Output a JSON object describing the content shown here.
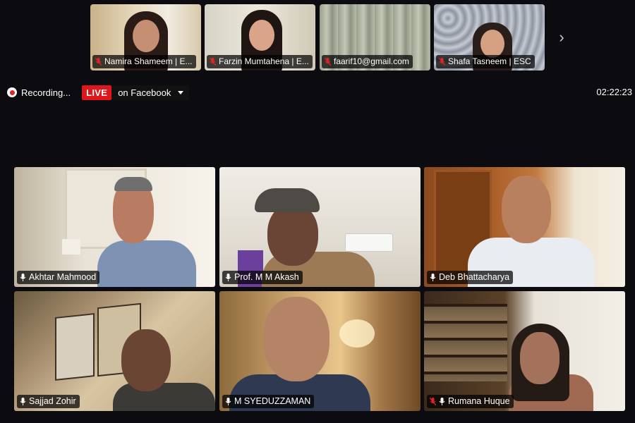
{
  "filmstrip": [
    {
      "name": "Namira Shameem | E...",
      "muted": true
    },
    {
      "name": "Farzin Mumtahena | E...",
      "muted": true
    },
    {
      "name": "faarif10@gmail.com",
      "muted": true
    },
    {
      "name": "Shafa Tasneem | ESC",
      "muted": true
    }
  ],
  "recording": {
    "label": "Recording...",
    "live_badge": "LIVE",
    "destination": "on Facebook"
  },
  "timer": "02:22:23",
  "gallery": [
    {
      "name": "Akhtar Mahmood",
      "muted": false,
      "active": false
    },
    {
      "name": "Prof. M M Akash",
      "muted": false,
      "active": false
    },
    {
      "name": "Deb Bhattacharya",
      "muted": false,
      "active": true
    },
    {
      "name": "Sajjad Zohir",
      "muted": false,
      "active": false
    },
    {
      "name": "M SYEDUZZAMAN",
      "muted": false,
      "active": false
    },
    {
      "name": "Rumana Huque",
      "muted": true,
      "active": false
    }
  ],
  "colors": {
    "background": "#0b0b10",
    "live_red": "#e0161d",
    "active_speaker": "#23d160",
    "muted_mic": "#e02424"
  }
}
